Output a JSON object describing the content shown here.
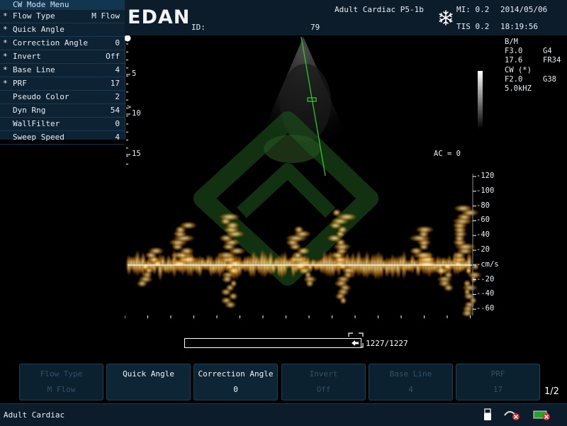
{
  "menu": {
    "title": "CW Mode Menu",
    "items": [
      {
        "mark": "*",
        "label": "Flow Type",
        "value": "M Flow"
      },
      {
        "mark": "*",
        "label": "Quick Angle",
        "value": ""
      },
      {
        "mark": "*",
        "label": "Correction Angle",
        "value": "0"
      },
      {
        "mark": "*",
        "label": "Invert",
        "value": "Off"
      },
      {
        "mark": "*",
        "label": "Base Line",
        "value": "4"
      },
      {
        "mark": "*",
        "label": "PRF",
        "value": "17"
      },
      {
        "mark": "",
        "label": "Pseudo Color",
        "value": "2"
      },
      {
        "mark": "",
        "label": "Dyn Rng",
        "value": "54"
      },
      {
        "mark": "",
        "label": "WallFilter",
        "value": "0"
      },
      {
        "mark": "",
        "label": "Sweep Speed",
        "value": "4"
      }
    ]
  },
  "header": {
    "logo": "EDAN",
    "id_label": "ID:",
    "id_value": "79",
    "exam": "Adult Cardiac P5-1b",
    "mi": "MI: 0.2",
    "tis": "TIS 0.2",
    "date": "2014/05/06",
    "time": "18:19:56"
  },
  "params": {
    "bm_title": "B/M",
    "bm_f": "F3.0",
    "bm_g": "G4",
    "bm_depth": "17.6",
    "bm_fr": "FR34",
    "cw_title": "CW (*)",
    "cw_f": "F2.0",
    "cw_g": "G38",
    "cw_prf": "5.0kHZ"
  },
  "depth_labels": [
    "5",
    "10",
    "15"
  ],
  "ac": "AC = 0",
  "velocity_scale": {
    "labels": [
      "-120",
      "-100",
      "-80",
      "-60",
      "-40",
      "-20",
      "-cm/s",
      "--20",
      "--40",
      "--60"
    ]
  },
  "cine": {
    "text": "1227/1227",
    "fraction": 1.0
  },
  "softkeys": [
    {
      "label": "Flow Type",
      "value": "M Flow",
      "enabled": false
    },
    {
      "label": "Quick Angle",
      "value": "",
      "enabled": true
    },
    {
      "label": "Correction Angle",
      "value": "0",
      "enabled": true
    },
    {
      "label": "Invert",
      "value": "Off",
      "enabled": false
    },
    {
      "label": "Base Line",
      "value": "4",
      "enabled": false
    },
    {
      "label": "PRF",
      "value": "17",
      "enabled": false
    }
  ],
  "page_indicator": "1/2",
  "status": {
    "text": "Adult Cardiac",
    "icons": [
      "usb-icon",
      "probe-disconnected-icon",
      "battery-disconnected-icon"
    ]
  },
  "colors": {
    "doppler": "#f0a020",
    "scanline": "#29d629",
    "watermark": "#1f5a1f"
  }
}
